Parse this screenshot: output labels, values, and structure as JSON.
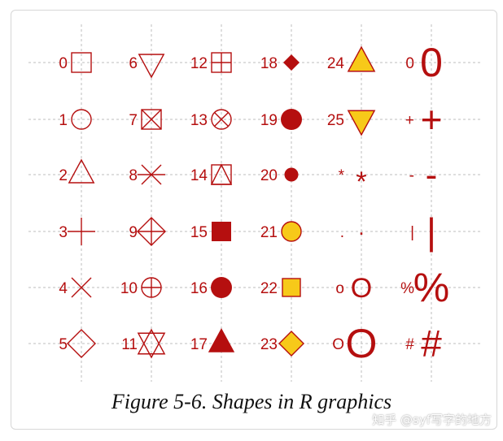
{
  "figure": {
    "caption": "Figure 5-6. Shapes in R graphics",
    "watermark": "知乎 @syf写字的地方"
  },
  "colors": {
    "stroke": "#b50f0f",
    "fill_red": "#b50f0f",
    "fill_yellow": "#f7c919",
    "grid": "#bdbdbd"
  },
  "columns": [
    [
      {
        "label": "0",
        "shape": "open-square"
      },
      {
        "label": "1",
        "shape": "open-circle"
      },
      {
        "label": "2",
        "shape": "open-triangle-up"
      },
      {
        "label": "3",
        "shape": "plus"
      },
      {
        "label": "4",
        "shape": "cross"
      },
      {
        "label": "5",
        "shape": "open-diamond"
      }
    ],
    [
      {
        "label": "6",
        "shape": "open-triangle-down"
      },
      {
        "label": "7",
        "shape": "square-cross"
      },
      {
        "label": "8",
        "shape": "asterisk"
      },
      {
        "label": "9",
        "shape": "diamond-plus"
      },
      {
        "label": "10",
        "shape": "circle-plus"
      },
      {
        "label": "11",
        "shape": "triangles-up-down"
      }
    ],
    [
      {
        "label": "12",
        "shape": "square-plus"
      },
      {
        "label": "13",
        "shape": "circle-cross"
      },
      {
        "label": "14",
        "shape": "square-triangle"
      },
      {
        "label": "15",
        "shape": "filled-square"
      },
      {
        "label": "16",
        "shape": "filled-circle"
      },
      {
        "label": "17",
        "shape": "filled-triangle"
      }
    ],
    [
      {
        "label": "18",
        "shape": "filled-diamond-small"
      },
      {
        "label": "19",
        "shape": "filled-circle-large"
      },
      {
        "label": "20",
        "shape": "filled-circle-small"
      },
      {
        "label": "21",
        "shape": "fill-circle"
      },
      {
        "label": "22",
        "shape": "fill-square"
      },
      {
        "label": "23",
        "shape": "fill-diamond"
      }
    ],
    [
      {
        "label": "24",
        "shape": "fill-triangle-up"
      },
      {
        "label": "25",
        "shape": "fill-triangle-down"
      },
      {
        "label": "*",
        "shape": "char",
        "char": "*"
      },
      {
        "label": ".",
        "shape": "char",
        "char": "."
      },
      {
        "label": "o",
        "shape": "char",
        "char": "O"
      },
      {
        "label": "O",
        "shape": "char",
        "char": "O"
      }
    ],
    [
      {
        "label": "0",
        "shape": "char",
        "char": "0"
      },
      {
        "label": "+",
        "shape": "char",
        "char": "+"
      },
      {
        "label": "-",
        "shape": "char",
        "char": "-"
      },
      {
        "label": "|",
        "shape": "char",
        "char": "|"
      },
      {
        "label": "%",
        "shape": "char",
        "char": "%"
      },
      {
        "label": "#",
        "shape": "char",
        "char": "#"
      }
    ]
  ]
}
